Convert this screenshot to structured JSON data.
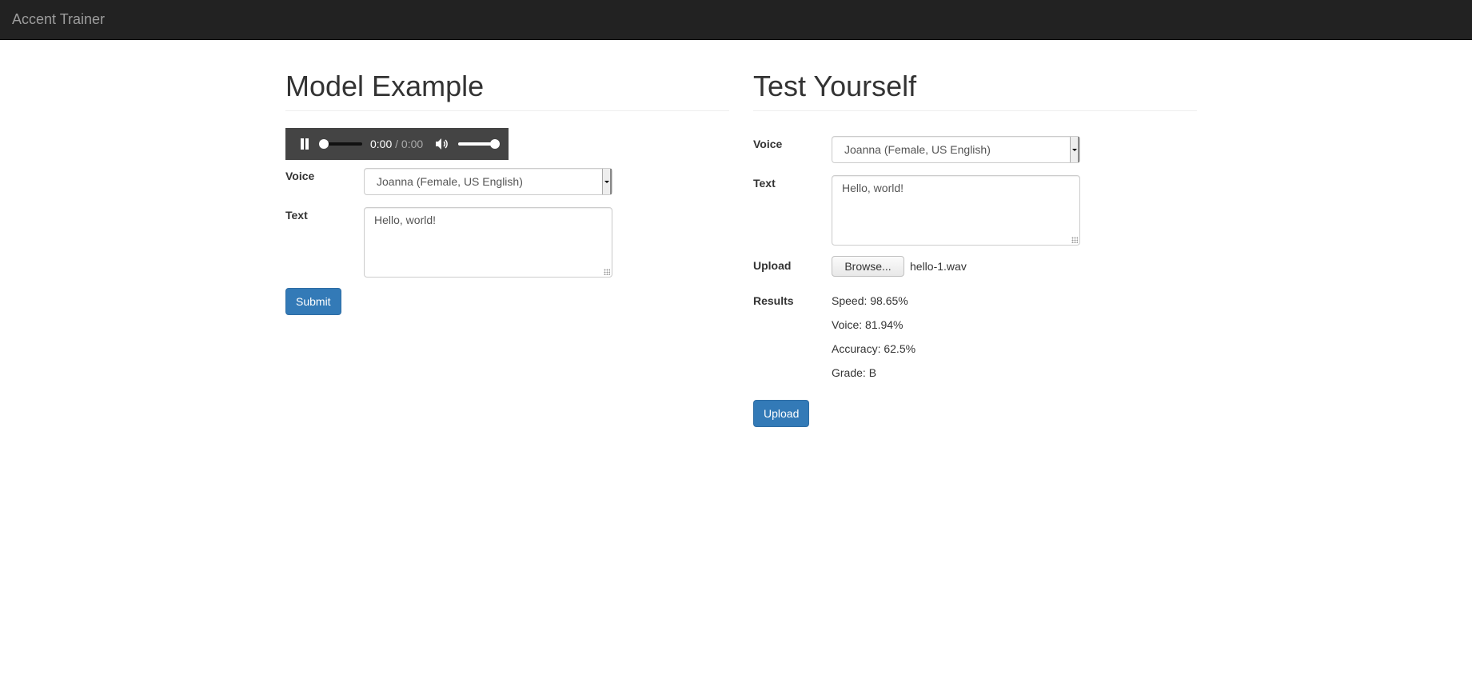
{
  "navbar": {
    "brand": "Accent Trainer"
  },
  "model": {
    "title": "Model Example",
    "audio": {
      "current_time": "0:00",
      "separator": " / ",
      "duration": "0:00",
      "playing": true,
      "progress": 0,
      "volume": 1.0
    },
    "voice_label": "Voice",
    "voice_value": "Joanna (Female, US English)",
    "text_label": "Text",
    "text_value": "Hello, world!",
    "submit_label": "Submit"
  },
  "test": {
    "title": "Test Yourself",
    "voice_label": "Voice",
    "voice_value": "Joanna (Female, US English)",
    "text_label": "Text",
    "text_value": "Hello, world!",
    "upload_label": "Upload",
    "browse_label": "Browse...",
    "file_name": "hello-1.wav",
    "results_label": "Results",
    "results": [
      "Speed: 98.65%",
      "Voice: 81.94%",
      "Accuracy: 62.5%",
      "Grade: B"
    ],
    "upload_button_label": "Upload"
  },
  "colors": {
    "navbar": "#222222",
    "primary": "#337ab7",
    "audio_bar": "#444444"
  }
}
